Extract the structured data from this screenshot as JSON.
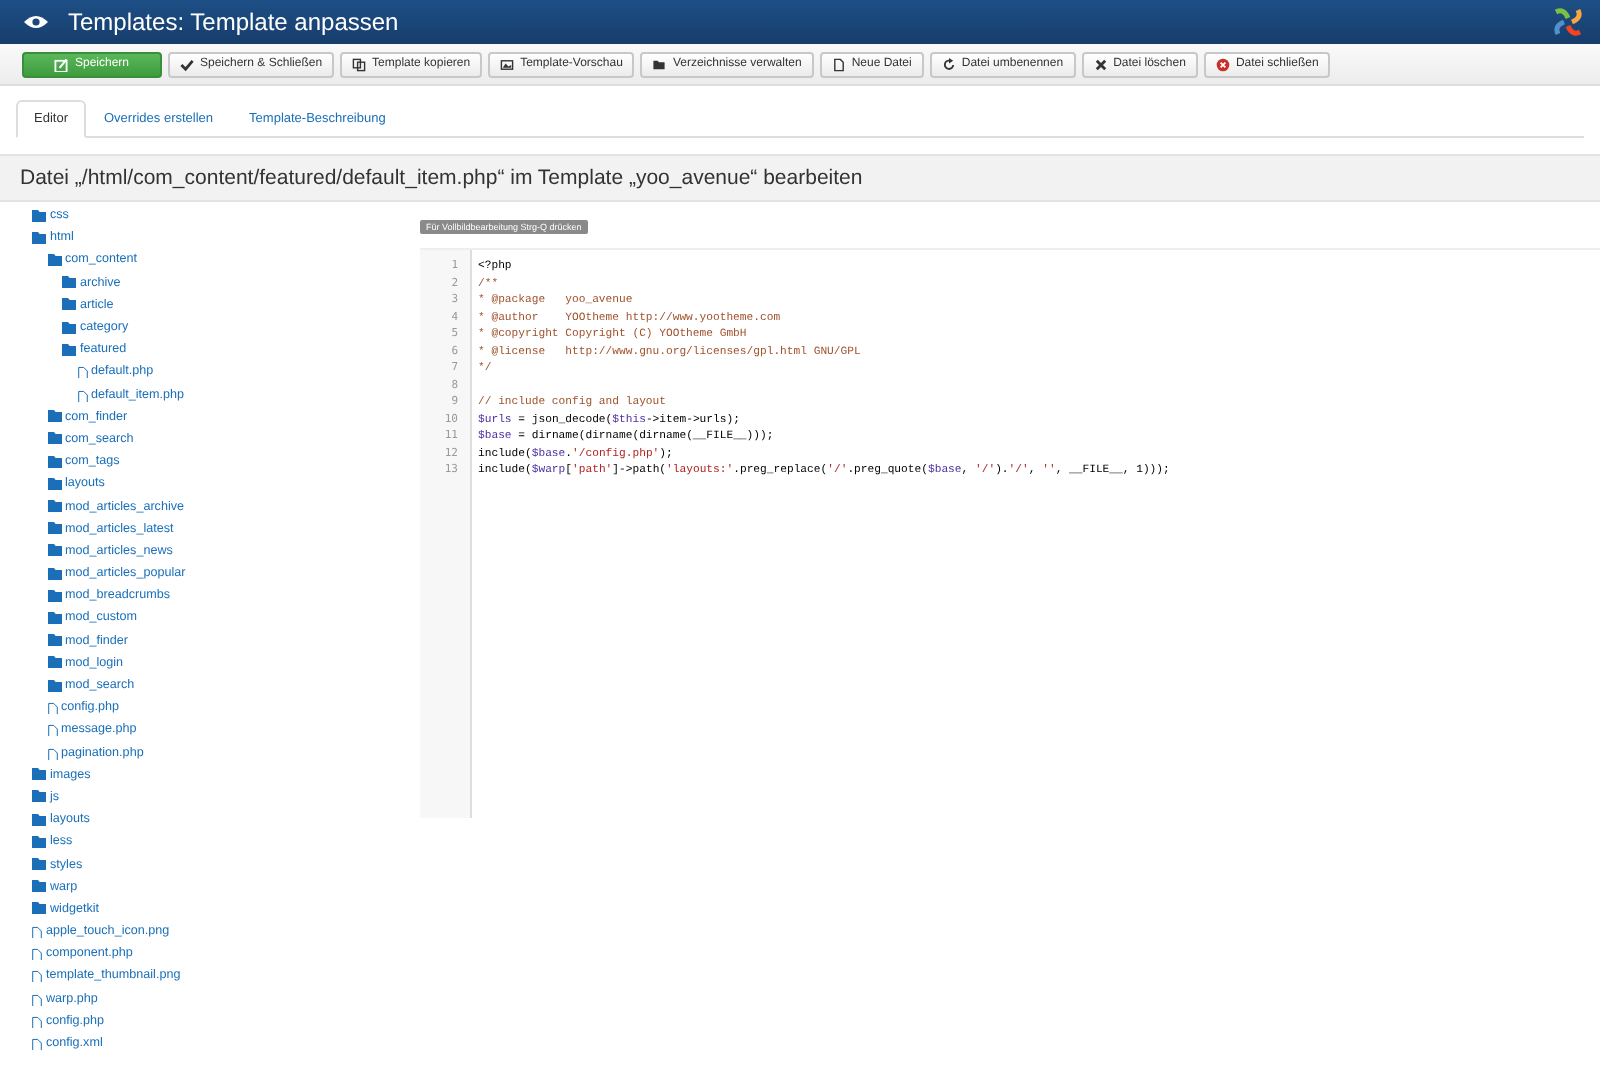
{
  "header": {
    "title": "Templates: Template anpassen"
  },
  "toolbar": [
    {
      "label": "Speichern",
      "kind": "primary"
    },
    {
      "label": "Speichern & Schließen",
      "kind": "default"
    },
    {
      "label": "Template kopieren",
      "kind": "default"
    },
    {
      "label": "Template-Vorschau",
      "kind": "default"
    },
    {
      "label": "Verzeichnisse verwalten",
      "kind": "default"
    },
    {
      "label": "Neue Datei",
      "kind": "default"
    },
    {
      "label": "Datei umbenennen",
      "kind": "default"
    },
    {
      "label": "Datei löschen",
      "kind": "default"
    },
    {
      "label": "Datei schließen",
      "kind": "default"
    }
  ],
  "tabs": [
    {
      "label": "Editor",
      "selected": true
    },
    {
      "label": "Overrides erstellen",
      "selected": false
    },
    {
      "label": "Template-Beschreibung",
      "selected": false
    }
  ],
  "heading": "Datei „/html/com_content/featured/default_item.php“ im Template „yoo_avenue“ bearbeiten",
  "tree": [
    {
      "name": "css",
      "kind": "folder"
    },
    {
      "name": "html",
      "kind": "folder",
      "children": [
        {
          "name": "com_content",
          "kind": "folder",
          "children": [
            {
              "name": "archive",
              "kind": "folder"
            },
            {
              "name": "article",
              "kind": "folder"
            },
            {
              "name": "category",
              "kind": "folder"
            },
            {
              "name": "featured",
              "kind": "folder",
              "children": [
                {
                  "name": "default.php",
                  "kind": "file"
                },
                {
                  "name": "default_item.php",
                  "kind": "file"
                }
              ]
            }
          ]
        },
        {
          "name": "com_finder",
          "kind": "folder"
        },
        {
          "name": "com_search",
          "kind": "folder"
        },
        {
          "name": "com_tags",
          "kind": "folder"
        },
        {
          "name": "layouts",
          "kind": "folder"
        },
        {
          "name": "mod_articles_archive",
          "kind": "folder"
        },
        {
          "name": "mod_articles_latest",
          "kind": "folder"
        },
        {
          "name": "mod_articles_news",
          "kind": "folder"
        },
        {
          "name": "mod_articles_popular",
          "kind": "folder"
        },
        {
          "name": "mod_breadcrumbs",
          "kind": "folder"
        },
        {
          "name": "mod_custom",
          "kind": "folder"
        },
        {
          "name": "mod_finder",
          "kind": "folder"
        },
        {
          "name": "mod_login",
          "kind": "folder"
        },
        {
          "name": "mod_search",
          "kind": "folder"
        },
        {
          "name": "config.php",
          "kind": "file"
        },
        {
          "name": "message.php",
          "kind": "file"
        },
        {
          "name": "pagination.php",
          "kind": "file"
        }
      ]
    },
    {
      "name": "images",
      "kind": "folder"
    },
    {
      "name": "js",
      "kind": "folder"
    },
    {
      "name": "layouts",
      "kind": "folder"
    },
    {
      "name": "less",
      "kind": "folder"
    },
    {
      "name": "styles",
      "kind": "folder"
    },
    {
      "name": "warp",
      "kind": "folder"
    },
    {
      "name": "widgetkit",
      "kind": "folder"
    },
    {
      "name": "apple_touch_icon.png",
      "kind": "file"
    },
    {
      "name": "component.php",
      "kind": "file"
    },
    {
      "name": "template_thumbnail.png",
      "kind": "file"
    },
    {
      "name": "warp.php",
      "kind": "file"
    },
    {
      "name": "config.php",
      "kind": "file"
    },
    {
      "name": "config.xml",
      "kind": "file"
    }
  ],
  "editor_hint": "Für Vollbildbearbeitung Strg-Q drücken",
  "code": [
    {
      "number": "1",
      "tokens": [
        {
          "text": "<?php",
          "kind": "plain"
        }
      ]
    },
    {
      "number": "2",
      "tokens": [
        {
          "text": "/**",
          "kind": "comment"
        }
      ]
    },
    {
      "number": "3",
      "tokens": [
        {
          "text": "* @package   yoo_avenue",
          "kind": "comment"
        }
      ]
    },
    {
      "number": "4",
      "tokens": [
        {
          "text": "* @author    YOOtheme http://www.yootheme.com",
          "kind": "comment"
        }
      ]
    },
    {
      "number": "5",
      "tokens": [
        {
          "text": "* @copyright Copyright (C) YOOtheme GmbH",
          "kind": "comment"
        }
      ]
    },
    {
      "number": "6",
      "tokens": [
        {
          "text": "* @license   http://www.gnu.org/licenses/gpl.html GNU/GPL",
          "kind": "comment"
        }
      ]
    },
    {
      "number": "7",
      "tokens": [
        {
          "text": "*/",
          "kind": "comment"
        }
      ]
    },
    {
      "number": "8"
    },
    {
      "number": "9",
      "tokens": [
        {
          "text": "// include config and layout",
          "kind": "comment"
        }
      ]
    },
    {
      "number": "10",
      "tokens": [
        {
          "text": "$urls",
          "kind": "var"
        },
        {
          "text": " = json_decode(",
          "kind": "plain"
        },
        {
          "text": "$this",
          "kind": "var"
        },
        {
          "text": "->item->urls);",
          "kind": "plain"
        }
      ]
    },
    {
      "number": "11",
      "tokens": [
        {
          "text": "$base",
          "kind": "var"
        },
        {
          "text": " = dirname(dirname(dirname(__FILE__)));",
          "kind": "plain"
        }
      ]
    },
    {
      "number": "12",
      "tokens": [
        {
          "text": "include(",
          "kind": "plain"
        },
        {
          "text": "$base",
          "kind": "var"
        },
        {
          "text": ".",
          "kind": "plain"
        },
        {
          "text": "'/config.php'",
          "kind": "string"
        },
        {
          "text": ");",
          "kind": "plain"
        }
      ]
    },
    {
      "number": "13",
      "tokens": [
        {
          "text": "include(",
          "kind": "plain"
        },
        {
          "text": "$warp",
          "kind": "var"
        },
        {
          "text": "[",
          "kind": "plain"
        },
        {
          "text": "'path'",
          "kind": "string"
        },
        {
          "text": "]->path(",
          "kind": "plain"
        },
        {
          "text": "'layouts:'",
          "kind": "string"
        },
        {
          "text": ".preg_replace(",
          "kind": "plain"
        },
        {
          "text": "'/'",
          "kind": "string"
        },
        {
          "text": ".preg_quote(",
          "kind": "plain"
        },
        {
          "text": "$base",
          "kind": "var"
        },
        {
          "text": ", ",
          "kind": "plain"
        },
        {
          "text": "'/'",
          "kind": "string"
        },
        {
          "text": ").",
          "kind": "plain"
        },
        {
          "text": "'/'",
          "kind": "string"
        },
        {
          "text": ", ",
          "kind": "plain"
        },
        {
          "text": "''",
          "kind": "string"
        },
        {
          "text": ", __FILE__, 1)));",
          "kind": "plain"
        }
      ]
    }
  ]
}
